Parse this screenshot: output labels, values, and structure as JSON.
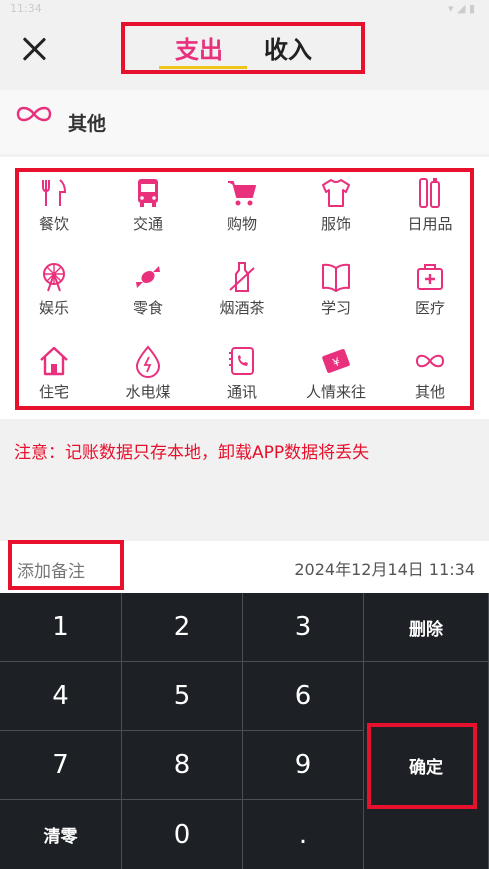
{
  "status": {
    "time": "11:34",
    "icons": "▾ ◢ ▮"
  },
  "header": {
    "tabs": [
      {
        "label": "支出",
        "active": true
      },
      {
        "label": "收入",
        "active": false
      }
    ]
  },
  "selected_category": {
    "icon": "infinity-icon",
    "label": "其他"
  },
  "categories": [
    {
      "label": "餐饮",
      "icon": "fork-knife-icon"
    },
    {
      "label": "交通",
      "icon": "bus-icon"
    },
    {
      "label": "购物",
      "icon": "cart-icon"
    },
    {
      "label": "服饰",
      "icon": "shirt-icon"
    },
    {
      "label": "日用品",
      "icon": "toothbrush-icon"
    },
    {
      "label": "娱乐",
      "icon": "ferris-wheel-icon"
    },
    {
      "label": "零食",
      "icon": "candy-icon"
    },
    {
      "label": "烟酒茶",
      "icon": "bottle-icon"
    },
    {
      "label": "学习",
      "icon": "book-icon"
    },
    {
      "label": "医疗",
      "icon": "medkit-icon"
    },
    {
      "label": "住宅",
      "icon": "house-icon"
    },
    {
      "label": "水电煤",
      "icon": "water-drop-icon"
    },
    {
      "label": "通讯",
      "icon": "phone-icon"
    },
    {
      "label": "人情来往",
      "icon": "ticket-icon"
    },
    {
      "label": "其他",
      "icon": "infinity-icon"
    }
  ],
  "notice": "注意：记账数据只存本地，卸载APP数据将丢失",
  "note": {
    "placeholder": "添加备注"
  },
  "datetime": "2024年12月14日 11:34",
  "keypad": {
    "k1": "1",
    "k2": "2",
    "k3": "3",
    "del": "删除",
    "k4": "4",
    "k5": "5",
    "k6": "6",
    "k7": "7",
    "k8": "8",
    "k9": "9",
    "confirm": "确定",
    "clear": "清零",
    "k0": "0",
    "dot": "."
  },
  "colors": {
    "accent": "#e8307d",
    "highlight": "#e8112d",
    "tab_underline": "#f0c419",
    "keypad_bg": "#1d2126"
  }
}
